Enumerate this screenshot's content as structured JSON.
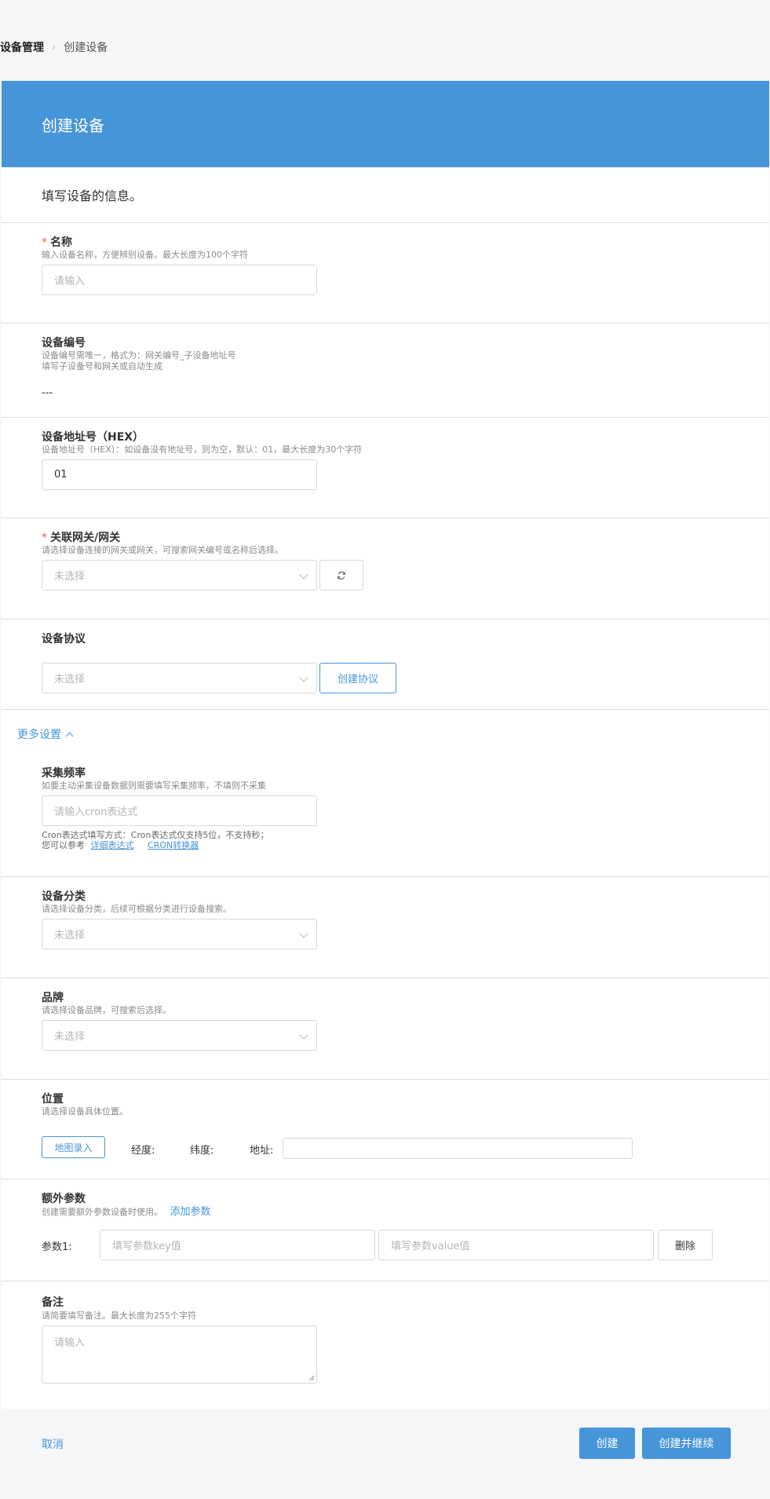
{
  "breadcrumb": {
    "root": "设备管理",
    "current": "创建设备"
  },
  "header": {
    "title": "创建设备"
  },
  "intro": "填写设备的信息。",
  "name": {
    "required": "*",
    "title": "名称",
    "desc": "输入设备名称，方便辨别设备。最大长度为100个字符",
    "placeholder": "请输入"
  },
  "device_code": {
    "title": "设备编号",
    "desc1": "设备编号需唯一，格式为：网关编号_子设备地址号",
    "desc2": "填写子设备号和网关或自动生成",
    "value": "---"
  },
  "address": {
    "title": "设备地址号（HEX）",
    "desc": "设备地址号（HEX）：如设备没有地址号，则为空，默认：01，最大长度为30个字符",
    "value": "01"
  },
  "gateway": {
    "required": "*",
    "title": "关联网关/网关",
    "desc": "请选择设备连接的网关或网关，可搜索网关编号或名称后选择。",
    "placeholder": "未选择",
    "refresh_icon": "refresh-icon"
  },
  "protocol": {
    "title": "设备协议",
    "placeholder": "未选择",
    "create_label": "创建协议"
  },
  "more": {
    "label": "更多设置",
    "icon": "chevron-up-icon"
  },
  "frequency": {
    "title": "采集频率",
    "desc": "如要主动采集设备数据则需要填写采集频率，不填则不采集",
    "placeholder": "请输入cron表达式",
    "hint1": "Cron表达式填写方式：Cron表达式仅支持5位，不支持秒；",
    "hint2_prefix": "您可以参考",
    "link1": "详细表达式",
    "link2": "CRON转换器"
  },
  "category": {
    "title": "设备分类",
    "desc": "请选择设备分类，后续可根据分类进行设备搜索。",
    "placeholder": "未选择"
  },
  "brand": {
    "title": "品牌",
    "desc": "请选择设备品牌，可搜索后选择。",
    "placeholder": "未选择"
  },
  "location": {
    "title": "位置",
    "desc": "请选择设备具体位置。",
    "map_label": "地图录入",
    "lng_label": "经度:",
    "lat_label": "纬度:",
    "addr_label": "地址:"
  },
  "params": {
    "title": "额外参数",
    "desc": "创建需要额外参数设备时使用。",
    "add_label": "添加参数",
    "row_label": "参数1:",
    "key_placeholder": "填写参数key值",
    "value_placeholder": "填写参数value值",
    "delete_label": "删除"
  },
  "remark": {
    "title": "备注",
    "desc": "请简要填写备注。最大长度为255个字符",
    "placeholder": "请输入"
  },
  "footer": {
    "cancel_label": "取消",
    "create_label": "创建",
    "create_continue_label": "创建并继续"
  }
}
